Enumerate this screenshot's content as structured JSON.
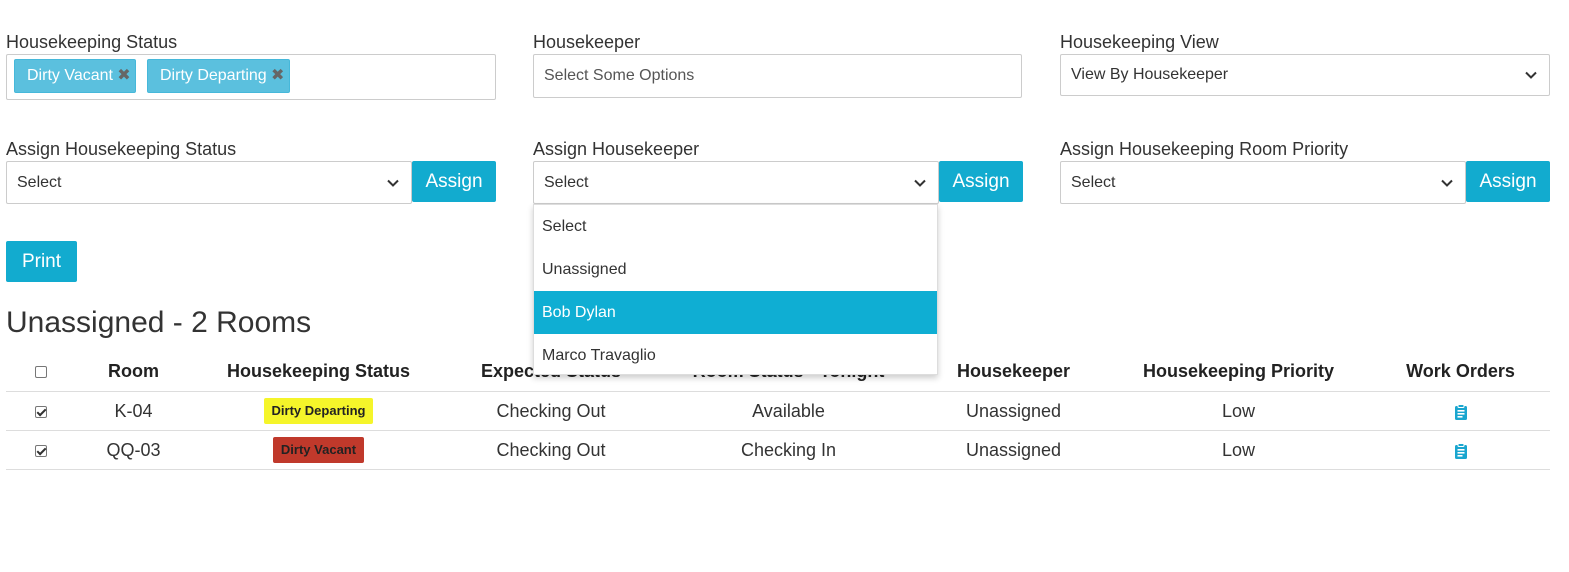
{
  "filters": {
    "status_label": "Housekeeping Status",
    "status_tags": [
      "Dirty Vacant",
      "Dirty Departing"
    ],
    "housekeeper_label": "Housekeeper",
    "housekeeper_placeholder": "Select Some Options",
    "view_label": "Housekeeping View",
    "view_value": "View By Housekeeper"
  },
  "assign": {
    "status_label": "Assign Housekeeping Status",
    "status_value": "Select",
    "housekeeper_label": "Assign Housekeeper",
    "housekeeper_value": "Select",
    "priority_label": "Assign Housekeeping Room Priority",
    "priority_value": "Select",
    "button_label": "Assign"
  },
  "dropdown_options": [
    "Select",
    "Unassigned",
    "Bob Dylan",
    "Marco Travaglio"
  ],
  "dropdown_selected": "Bob Dylan",
  "print_label": "Print",
  "section_title": "Unassigned - 2 Rooms",
  "table": {
    "headers": [
      "Room",
      "Housekeeping Status",
      "Expected Status",
      "Room Status - Tonight",
      "Housekeeper",
      "Housekeeping Priority",
      "Work Orders"
    ],
    "rows": [
      {
        "checked": true,
        "room": "K-04",
        "status": "Dirty Departing",
        "status_color": "#f5f52a",
        "expected": "Checking Out",
        "tonight": "Available",
        "housekeeper": "Unassigned",
        "priority": "Low",
        "work_order_icon": "clipboard-icon"
      },
      {
        "checked": true,
        "room": "QQ-03",
        "status": "Dirty Vacant",
        "status_color": "#c0392b",
        "expected": "Checking Out",
        "tonight": "Checking In",
        "housekeeper": "Unassigned",
        "priority": "Low",
        "work_order_icon": "clipboard-icon"
      }
    ]
  },
  "colors": {
    "accent": "#12abcf",
    "tag": "#5bc0de"
  }
}
